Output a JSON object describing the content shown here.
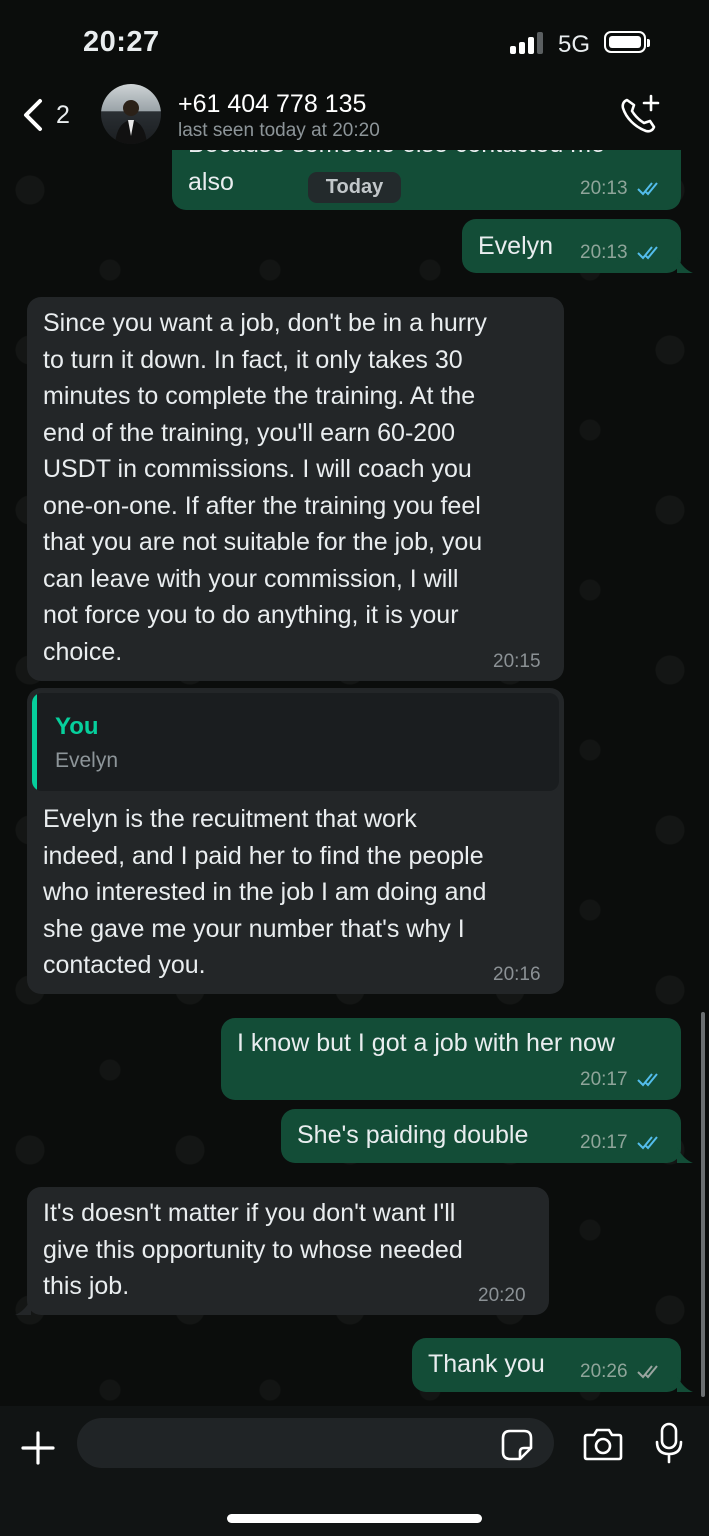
{
  "status_bar": {
    "time": "20:27",
    "network": "5G"
  },
  "header": {
    "back_count": "2",
    "contact_name": "+61 404 778 135",
    "contact_status": "last seen today at 20:20"
  },
  "date_separator": "Today",
  "messages": [
    {
      "id": "m1",
      "direction": "outgoing",
      "text": "also",
      "partial_text": "Because someone else contacted me",
      "time": "20:13",
      "status": "read"
    },
    {
      "id": "m2",
      "direction": "outgoing",
      "text": "Evelyn",
      "time": "20:13",
      "status": "read"
    },
    {
      "id": "m3",
      "direction": "incoming",
      "text": "Since you want a job, don't be in a hurry\nto turn it down. In fact, it only takes 30\nminutes to complete the training. At the\nend of the training, you'll earn 60-200\nUSDT in commissions. I will coach you\none-on-one. If after the training you feel\nthat you are not suitable for the job, you\ncan leave with your commission, I will\nnot force you to do anything, it is your\nchoice.",
      "time": "20:15"
    },
    {
      "id": "m4",
      "direction": "incoming",
      "quote_author": "You",
      "quote_text": "Evelyn",
      "text": "Evelyn is the recuitment that work\nindeed, and I paid her to find the people\nwho interested in the job I am doing and\nshe gave me your number that's why I\ncontacted you.",
      "time": "20:16"
    },
    {
      "id": "m5",
      "direction": "outgoing",
      "text": "I know but I got a job with her now",
      "time": "20:17",
      "status": "read"
    },
    {
      "id": "m6",
      "direction": "outgoing",
      "text": "She's paiding double",
      "time": "20:17",
      "status": "read"
    },
    {
      "id": "m7",
      "direction": "incoming",
      "text": "It's doesn't matter if you don't want I'll\ngive this opportunity to whose needed\nthis job.",
      "time": "20:20"
    },
    {
      "id": "m8",
      "direction": "outgoing",
      "text": "Thank you",
      "time": "20:26",
      "status": "delivered"
    }
  ],
  "input": {
    "placeholder": ""
  },
  "colors": {
    "outgoing_bubble": "#134d37",
    "incoming_bubble": "#232628",
    "read_tick": "#53bdeb",
    "accent": "#06cf9c"
  },
  "icons": [
    "back-chevron-icon",
    "call-add-icon",
    "plus-icon",
    "sticker-icon",
    "camera-icon",
    "microphone-icon",
    "double-check-icon"
  ]
}
